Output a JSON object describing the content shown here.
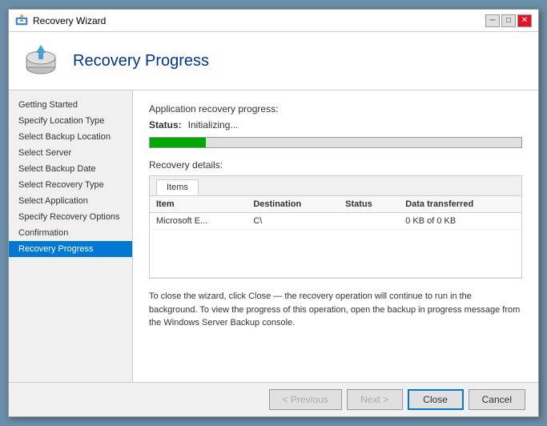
{
  "window": {
    "title": "Recovery Wizard",
    "close_label": "✕",
    "minimize_label": "─",
    "maximize_label": "□"
  },
  "header": {
    "title": "Recovery Progress"
  },
  "sidebar": {
    "items": [
      {
        "label": "Getting Started",
        "active": false
      },
      {
        "label": "Specify Location Type",
        "active": false
      },
      {
        "label": "Select Backup Location",
        "active": false
      },
      {
        "label": "Select Server",
        "active": false
      },
      {
        "label": "Select Backup Date",
        "active": false
      },
      {
        "label": "Select Recovery Type",
        "active": false
      },
      {
        "label": "Select Application",
        "active": false
      },
      {
        "label": "Specify Recovery Options",
        "active": false
      },
      {
        "label": "Confirmation",
        "active": false
      },
      {
        "label": "Recovery Progress",
        "active": true
      }
    ]
  },
  "main": {
    "progress_section_label": "Application recovery progress:",
    "status_label": "Status:",
    "status_value": "Initializing...",
    "progress_percent": 15,
    "recovery_details_label": "Recovery details:",
    "tab_label": "Items",
    "table": {
      "columns": [
        "Item",
        "Destination",
        "Status",
        "Data transferred"
      ],
      "rows": [
        {
          "item": "Microsoft E...",
          "destination": "C\\",
          "status": "",
          "data_transferred": "0 KB of 0 KB"
        }
      ]
    },
    "footer_text": "To close the wizard, click Close — the recovery operation will continue to run in the background. To view the progress of this operation, open the backup in progress message from the Windows Server Backup console."
  },
  "buttons": {
    "previous": "< Previous",
    "next": "Next >",
    "close": "Close",
    "cancel": "Cancel"
  }
}
